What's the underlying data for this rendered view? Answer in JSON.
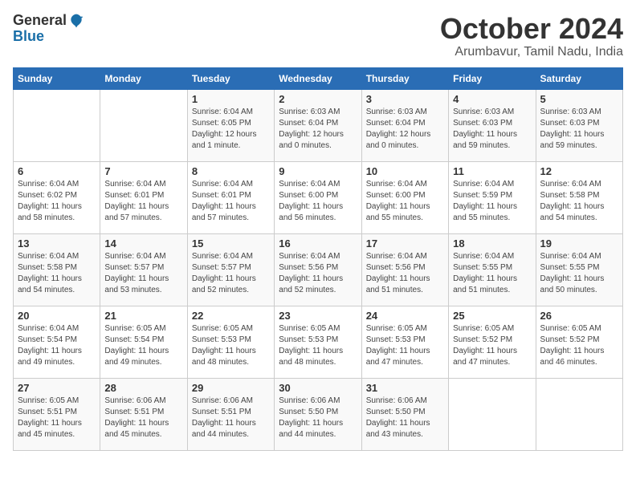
{
  "logo": {
    "general": "General",
    "blue": "Blue"
  },
  "title": "October 2024",
  "subtitle": "Arumbavur, Tamil Nadu, India",
  "headers": [
    "Sunday",
    "Monday",
    "Tuesday",
    "Wednesday",
    "Thursday",
    "Friday",
    "Saturday"
  ],
  "weeks": [
    [
      {
        "day": "",
        "info": ""
      },
      {
        "day": "",
        "info": ""
      },
      {
        "day": "1",
        "info": "Sunrise: 6:04 AM\nSunset: 6:05 PM\nDaylight: 12 hours\nand 1 minute."
      },
      {
        "day": "2",
        "info": "Sunrise: 6:03 AM\nSunset: 6:04 PM\nDaylight: 12 hours\nand 0 minutes."
      },
      {
        "day": "3",
        "info": "Sunrise: 6:03 AM\nSunset: 6:04 PM\nDaylight: 12 hours\nand 0 minutes."
      },
      {
        "day": "4",
        "info": "Sunrise: 6:03 AM\nSunset: 6:03 PM\nDaylight: 11 hours\nand 59 minutes."
      },
      {
        "day": "5",
        "info": "Sunrise: 6:03 AM\nSunset: 6:03 PM\nDaylight: 11 hours\nand 59 minutes."
      }
    ],
    [
      {
        "day": "6",
        "info": "Sunrise: 6:04 AM\nSunset: 6:02 PM\nDaylight: 11 hours\nand 58 minutes."
      },
      {
        "day": "7",
        "info": "Sunrise: 6:04 AM\nSunset: 6:01 PM\nDaylight: 11 hours\nand 57 minutes."
      },
      {
        "day": "8",
        "info": "Sunrise: 6:04 AM\nSunset: 6:01 PM\nDaylight: 11 hours\nand 57 minutes."
      },
      {
        "day": "9",
        "info": "Sunrise: 6:04 AM\nSunset: 6:00 PM\nDaylight: 11 hours\nand 56 minutes."
      },
      {
        "day": "10",
        "info": "Sunrise: 6:04 AM\nSunset: 6:00 PM\nDaylight: 11 hours\nand 55 minutes."
      },
      {
        "day": "11",
        "info": "Sunrise: 6:04 AM\nSunset: 5:59 PM\nDaylight: 11 hours\nand 55 minutes."
      },
      {
        "day": "12",
        "info": "Sunrise: 6:04 AM\nSunset: 5:58 PM\nDaylight: 11 hours\nand 54 minutes."
      }
    ],
    [
      {
        "day": "13",
        "info": "Sunrise: 6:04 AM\nSunset: 5:58 PM\nDaylight: 11 hours\nand 54 minutes."
      },
      {
        "day": "14",
        "info": "Sunrise: 6:04 AM\nSunset: 5:57 PM\nDaylight: 11 hours\nand 53 minutes."
      },
      {
        "day": "15",
        "info": "Sunrise: 6:04 AM\nSunset: 5:57 PM\nDaylight: 11 hours\nand 52 minutes."
      },
      {
        "day": "16",
        "info": "Sunrise: 6:04 AM\nSunset: 5:56 PM\nDaylight: 11 hours\nand 52 minutes."
      },
      {
        "day": "17",
        "info": "Sunrise: 6:04 AM\nSunset: 5:56 PM\nDaylight: 11 hours\nand 51 minutes."
      },
      {
        "day": "18",
        "info": "Sunrise: 6:04 AM\nSunset: 5:55 PM\nDaylight: 11 hours\nand 51 minutes."
      },
      {
        "day": "19",
        "info": "Sunrise: 6:04 AM\nSunset: 5:55 PM\nDaylight: 11 hours\nand 50 minutes."
      }
    ],
    [
      {
        "day": "20",
        "info": "Sunrise: 6:04 AM\nSunset: 5:54 PM\nDaylight: 11 hours\nand 49 minutes."
      },
      {
        "day": "21",
        "info": "Sunrise: 6:05 AM\nSunset: 5:54 PM\nDaylight: 11 hours\nand 49 minutes."
      },
      {
        "day": "22",
        "info": "Sunrise: 6:05 AM\nSunset: 5:53 PM\nDaylight: 11 hours\nand 48 minutes."
      },
      {
        "day": "23",
        "info": "Sunrise: 6:05 AM\nSunset: 5:53 PM\nDaylight: 11 hours\nand 48 minutes."
      },
      {
        "day": "24",
        "info": "Sunrise: 6:05 AM\nSunset: 5:53 PM\nDaylight: 11 hours\nand 47 minutes."
      },
      {
        "day": "25",
        "info": "Sunrise: 6:05 AM\nSunset: 5:52 PM\nDaylight: 11 hours\nand 47 minutes."
      },
      {
        "day": "26",
        "info": "Sunrise: 6:05 AM\nSunset: 5:52 PM\nDaylight: 11 hours\nand 46 minutes."
      }
    ],
    [
      {
        "day": "27",
        "info": "Sunrise: 6:05 AM\nSunset: 5:51 PM\nDaylight: 11 hours\nand 45 minutes."
      },
      {
        "day": "28",
        "info": "Sunrise: 6:06 AM\nSunset: 5:51 PM\nDaylight: 11 hours\nand 45 minutes."
      },
      {
        "day": "29",
        "info": "Sunrise: 6:06 AM\nSunset: 5:51 PM\nDaylight: 11 hours\nand 44 minutes."
      },
      {
        "day": "30",
        "info": "Sunrise: 6:06 AM\nSunset: 5:50 PM\nDaylight: 11 hours\nand 44 minutes."
      },
      {
        "day": "31",
        "info": "Sunrise: 6:06 AM\nSunset: 5:50 PM\nDaylight: 11 hours\nand 43 minutes."
      },
      {
        "day": "",
        "info": ""
      },
      {
        "day": "",
        "info": ""
      }
    ]
  ]
}
